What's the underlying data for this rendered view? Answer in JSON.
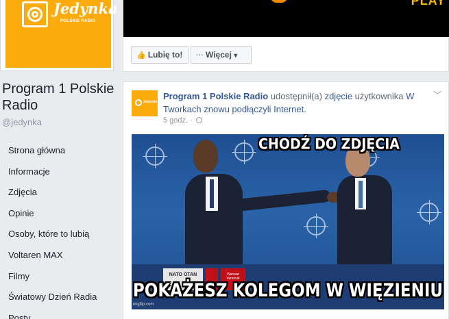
{
  "page": {
    "logo_name": "Jedynka",
    "logo_sub": "POLSKIE RADIO",
    "name": "Program 1 Polskie Radio",
    "handle": "@jedynka"
  },
  "nav": [
    {
      "label": "Strona główna"
    },
    {
      "label": "Informacje"
    },
    {
      "label": "Zdjęcia"
    },
    {
      "label": "Opinie"
    },
    {
      "label": "Osoby, które to lubią"
    },
    {
      "label": "Voltaren MAX"
    },
    {
      "label": "Filmy"
    },
    {
      "label": "Światowy Dzień Radia"
    },
    {
      "label": "Posty"
    }
  ],
  "cover": {
    "text": "PLAY"
  },
  "actions": {
    "like_label": "Lubię to!",
    "more_label": "Więcej",
    "more_dots": "···",
    "like_icon": "thumbs-up-icon",
    "caret": "▾"
  },
  "post": {
    "author": "Program 1 Polskie Radio",
    "verb": "udostępnił(a)",
    "photo_link": "zdjęcie",
    "owner_prefix": "użytkownika",
    "owner": "W Tworkach znowu podłączyli Internet.",
    "time": "5 godz.",
    "dot": "·",
    "chevron": "﹀",
    "avatar_text": "Jedynka",
    "meme_top": "CHODŹ DO ZDJĘCIA",
    "meme_bottom": "POKAŻESZ KOLEGOM W WIĘZIENIU",
    "watermark": "imgflip.com",
    "sign_text": "NATO OTAN",
    "sign_text2": "Warsaw Varsovie"
  },
  "colors": {
    "brand": "#fbab0c",
    "link": "#365899",
    "background": "#e9ebee"
  }
}
